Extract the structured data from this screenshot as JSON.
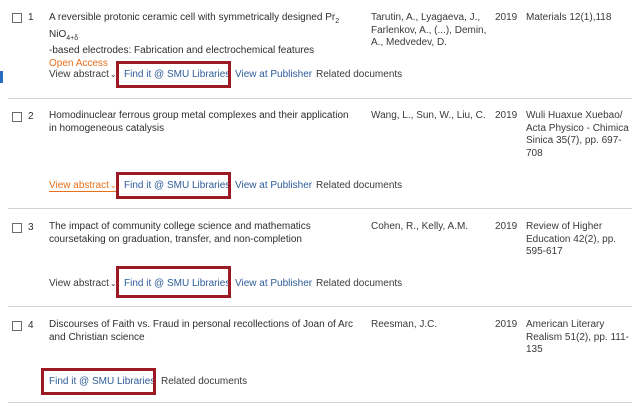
{
  "results": [
    {
      "num": "1",
      "title_part1": "A reversible protonic ceramic cell with symmetrically designed Pr",
      "title_sub1": "2",
      "title_part2": " NiO",
      "title_sub2": "4+δ",
      "title_part3": "-based electrodes: Fabrication and electrochemical features",
      "open_access": "Open Access",
      "authors": "Tarutin, A., Lyagaeva, J., Farlenkov, A., (...), Demin, A., Medvedev, D.",
      "year": "2019",
      "source": "Materials 12(1),118",
      "view_abstract": "View abstract",
      "find_it": "Find it @ SMU Libraries",
      "view_publisher": "View at Publisher",
      "related": "Related documents"
    },
    {
      "num": "2",
      "title": "Homodinuclear ferrous group metal complexes and their application in homogeneous catalysis",
      "authors": "Wang, L., Sun, W., Liu, C.",
      "year": "2019",
      "source": "Wuli Huaxue Xuebao/ Acta Physico - Chimica Sinica 35(7), pp. 697-708",
      "view_abstract": "View abstract",
      "find_it": "Find it @ SMU Libraries",
      "view_publisher": "View at Publisher",
      "related": "Related documents"
    },
    {
      "num": "3",
      "title": "The impact of community college science and mathematics coursetaking on graduation, transfer, and non-completion",
      "authors": "Cohen, R., Kelly, A.M.",
      "year": "2019",
      "source": "Review of Higher Education 42(2), pp. 595-617",
      "view_abstract": "View abstract",
      "find_it": "Find it @ SMU Libraries",
      "view_publisher": "View at Publisher",
      "related": "Related documents"
    },
    {
      "num": "4",
      "title": "Discourses of Faith vs. Fraud in personal recollections of Joan of Arc and Christian science",
      "authors": "Reesman, J.C.",
      "year": "2019",
      "source": "American Literary Realism 51(2), pp. 111-135",
      "find_it": "Find it @ SMU Libraries",
      "related": "Related documents"
    }
  ],
  "colors": {
    "highlight_box": "#9b1a24",
    "link": "#2e5c99",
    "open_access": "#e9711c"
  },
  "icons": {
    "chevron": "chevron-down-icon"
  }
}
